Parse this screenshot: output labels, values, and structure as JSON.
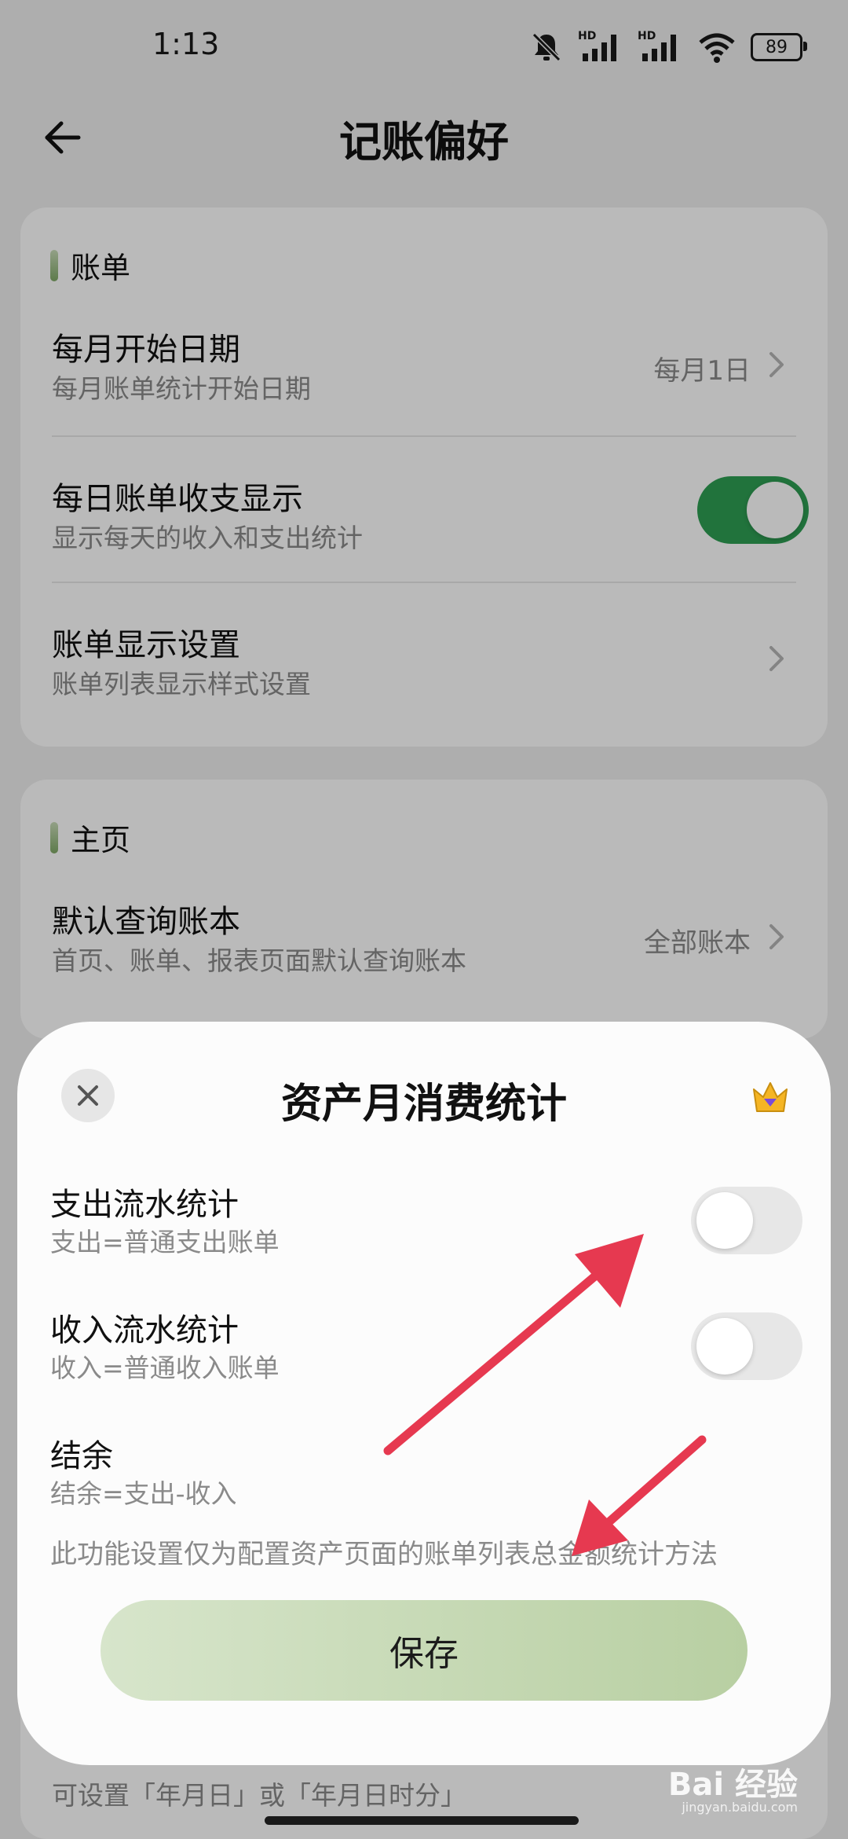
{
  "status_bar": {
    "time": "1:13",
    "battery": "89",
    "network_tag_1": "HD",
    "network_tag_2": "HD"
  },
  "header": {
    "title": "记账偏好"
  },
  "bill_section": {
    "title": "账单",
    "items": [
      {
        "title": "每月开始日期",
        "subtitle": "每月账单统计开始日期",
        "value": "每月1日"
      },
      {
        "title": "每日账单收支显示",
        "subtitle": "显示每天的收入和支出统计",
        "toggle_on": true
      },
      {
        "title": "账单显示设置",
        "subtitle": "账单列表显示样式设置"
      }
    ]
  },
  "home_section": {
    "title": "主页",
    "items": [
      {
        "title": "默认查询账本",
        "subtitle": "首页、账单、报表页面默认查询账本",
        "value": "全部账本"
      }
    ]
  },
  "time_section": {
    "subtitle": "可设置「年月日」或「年月日时分」"
  },
  "sheet": {
    "title": "资产月消费统计",
    "rows": [
      {
        "title": "支出流水统计",
        "subtitle": "支出=普通支出账单",
        "toggle_on": false
      },
      {
        "title": "收入流水统计",
        "subtitle": "收入=普通收入账单",
        "toggle_on": false
      },
      {
        "title": "结余",
        "subtitle": "结余=支出-收入"
      }
    ],
    "note": "此功能设置仅为配置资产页面的账单列表总金额统计方法",
    "save_label": "保存"
  },
  "watermark": {
    "text": "Bai 经验",
    "sub": "jingyan.baidu.com"
  },
  "colors": {
    "toggle_on": "#2e9e53",
    "toggle_off": "#e7e7e7",
    "arrow": "#e63950",
    "save_button": "#c5d9b3"
  },
  "icons": {
    "back": "back-arrow-icon",
    "chevron": "chevron-right-icon",
    "close": "close-icon",
    "crown": "vip-crown-icon"
  }
}
